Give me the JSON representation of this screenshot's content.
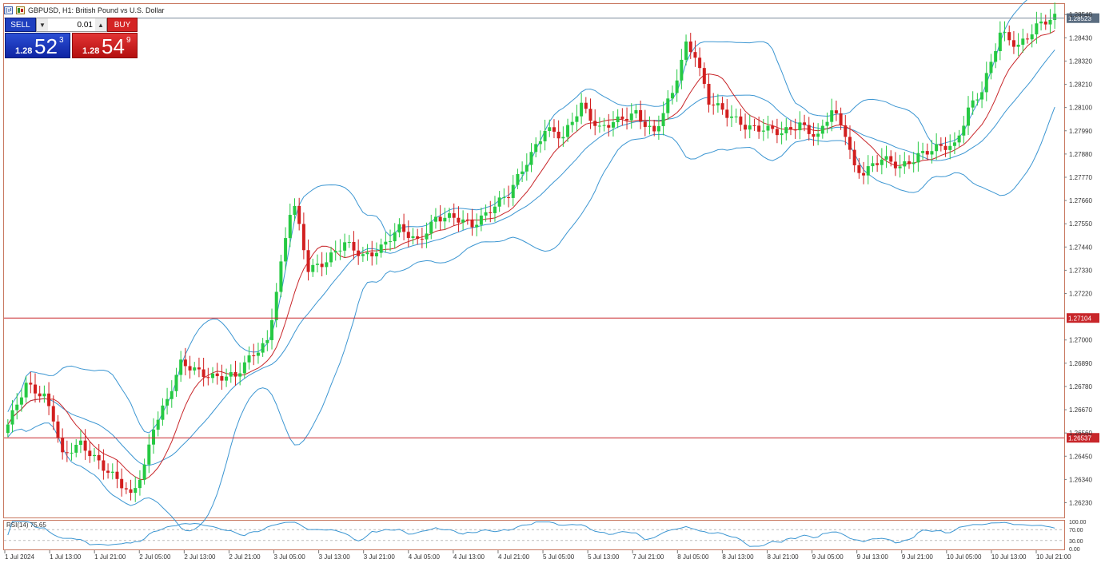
{
  "window": {
    "title": "GBPUSD, H1:  British Pound vs U.S. Dollar"
  },
  "trade_panel": {
    "sell_label": "SELL",
    "buy_label": "BUY",
    "lot": "0.01",
    "sell_price_small": "1.28",
    "sell_price_big": "52",
    "sell_price_sup": "3",
    "buy_price_small": "1.28",
    "buy_price_big": "54",
    "buy_price_sup": "9"
  },
  "colors": {
    "bull": "#26c943",
    "bear": "#d21f1f",
    "bollinger": "#3c96d2",
    "ma": "#c8262a",
    "hline": "#c8262a",
    "grid_border": "#c87860"
  },
  "chart_data": {
    "type": "candlestick",
    "symbol": "GBPUSD",
    "timeframe": "H1",
    "y_ticks": [
      "1.28540",
      "1.28430",
      "1.28320",
      "1.28210",
      "1.28100",
      "1.27990",
      "1.27880",
      "1.27770",
      "1.27660",
      "1.27550",
      "1.27440",
      "1.27330",
      "1.27220",
      "1.27000",
      "1.26890",
      "1.26780",
      "1.26670",
      "1.26560",
      "1.26450",
      "1.26340",
      "1.26230"
    ],
    "ylim": [
      1.2616,
      1.2859
    ],
    "x_ticks": [
      "1 Jul 2024",
      "1 Jul 13:00",
      "1 Jul 21:00",
      "2 Jul 05:00",
      "2 Jul 13:00",
      "2 Jul 21:00",
      "3 Jul 05:00",
      "3 Jul 13:00",
      "3 Jul 21:00",
      "4 Jul 05:00",
      "4 Jul 13:00",
      "4 Jul 21:00",
      "5 Jul 05:00",
      "5 Jul 13:00",
      "7 Jul 21:00",
      "8 Jul 05:00",
      "8 Jul 13:00",
      "8 Jul 21:00",
      "9 Jul 05:00",
      "9 Jul 13:00",
      "9 Jul 21:00",
      "10 Jul 05:00",
      "10 Jul 13:00",
      "10 Jul 21:00"
    ],
    "price_lines": [
      {
        "value": 1.28523,
        "label": "1.28523"
      },
      {
        "value": 1.27104,
        "label": "1.27104"
      },
      {
        "value": 1.26537,
        "label": "1.26537"
      }
    ],
    "close_anchors": [
      [
        0,
        1.266
      ],
      [
        4,
        1.2678
      ],
      [
        8,
        1.2674
      ],
      [
        10,
        1.2664
      ],
      [
        12,
        1.2645
      ],
      [
        16,
        1.265
      ],
      [
        20,
        1.2643
      ],
      [
        24,
        1.2634
      ],
      [
        27,
        1.2625
      ],
      [
        30,
        1.264
      ],
      [
        32,
        1.266
      ],
      [
        35,
        1.2672
      ],
      [
        38,
        1.2688
      ],
      [
        42,
        1.2685
      ],
      [
        46,
        1.2683
      ],
      [
        50,
        1.2682
      ],
      [
        54,
        1.2694
      ],
      [
        57,
        1.27
      ],
      [
        60,
        1.2735
      ],
      [
        62,
        1.276
      ],
      [
        63,
        1.2762
      ],
      [
        66,
        1.2734
      ],
      [
        70,
        1.2738
      ],
      [
        74,
        1.2745
      ],
      [
        78,
        1.274
      ],
      [
        82,
        1.2744
      ],
      [
        86,
        1.2752
      ],
      [
        90,
        1.2747
      ],
      [
        94,
        1.2758
      ],
      [
        98,
        1.2757
      ],
      [
        102,
        1.2755
      ],
      [
        106,
        1.2762
      ],
      [
        110,
        1.2768
      ],
      [
        114,
        1.2785
      ],
      [
        118,
        1.28
      ],
      [
        122,
        1.2795
      ],
      [
        126,
        1.2812
      ],
      [
        130,
        1.28
      ],
      [
        134,
        1.2803
      ],
      [
        138,
        1.2808
      ],
      [
        142,
        1.2798
      ],
      [
        146,
        1.2816
      ],
      [
        149,
        1.284
      ],
      [
        151,
        1.2836
      ],
      [
        154,
        1.2813
      ],
      [
        158,
        1.2806
      ],
      [
        162,
        1.2802
      ],
      [
        166,
        1.28
      ],
      [
        170,
        1.2797
      ],
      [
        174,
        1.2803
      ],
      [
        178,
        1.2796
      ],
      [
        181,
        1.2808
      ],
      [
        184,
        1.2798
      ],
      [
        186,
        1.2782
      ],
      [
        188,
        1.278
      ],
      [
        192,
        1.2785
      ],
      [
        196,
        1.2782
      ],
      [
        200,
        1.2788
      ],
      [
        204,
        1.279
      ],
      [
        208,
        1.2792
      ],
      [
        211,
        1.281
      ],
      [
        214,
        1.2818
      ],
      [
        216,
        1.283
      ],
      [
        218,
        1.2845
      ],
      [
        222,
        1.284
      ],
      [
        226,
        1.2848
      ],
      [
        230,
        1.2852
      ]
    ],
    "indicators": {
      "bollinger_bands": true,
      "moving_average": true,
      "rsi": {
        "label": "RSI(14) 75.65",
        "y_ticks": [
          "100.00",
          "70.00",
          "30.00",
          "0.00"
        ],
        "levels": [
          70,
          30
        ],
        "value": 75.65
      }
    },
    "grid": false
  }
}
